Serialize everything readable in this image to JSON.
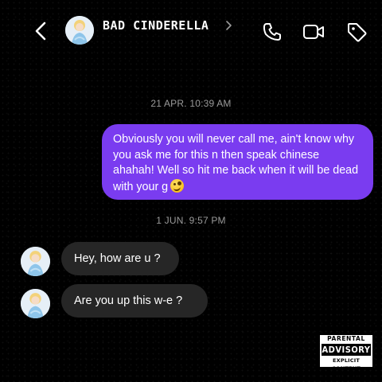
{
  "header": {
    "contact_name": "BAD CINDERELLA",
    "icons": [
      "back-icon",
      "avatar",
      "chevron-right-icon",
      "phone-icon",
      "video-camera-icon",
      "tag-icon"
    ]
  },
  "messages": [
    {
      "type": "timestamp",
      "text": "21 APR. 10:39 AM"
    },
    {
      "type": "outgoing",
      "text": "Obviously you will never call me, ain't know why you ask me for this n then speak chinese ahahah! Well so hit me back when it will be dead with your g",
      "emoji": "zany-face-emoji"
    },
    {
      "type": "timestamp",
      "text": "1 JUN. 9:57 PM"
    },
    {
      "type": "incoming",
      "text": "Hey, how are u ?"
    },
    {
      "type": "incoming",
      "text": "Are you up this w-e ?"
    }
  ],
  "advisory": {
    "top": "PARENTAL",
    "middle": "ADVISORY",
    "bottom": "EXPLICIT CONTENT"
  },
  "colors": {
    "background": "#000000",
    "outgoing_bubble": "#7a3cf0",
    "incoming_bubble": "#262626",
    "timestamp": "#9a9a9a"
  }
}
